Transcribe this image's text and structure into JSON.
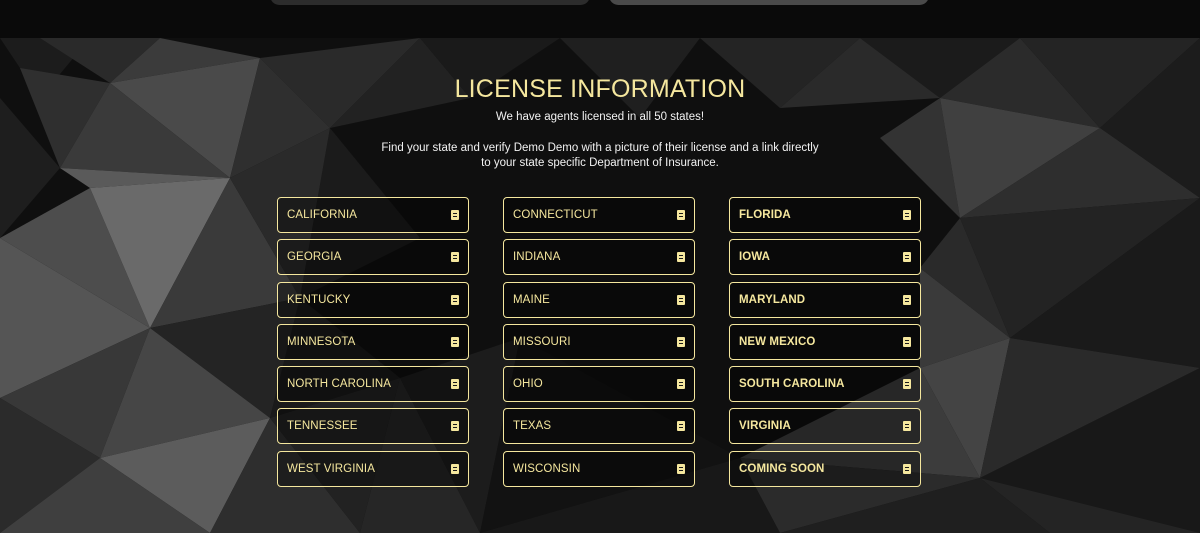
{
  "section": {
    "title": "LICENSE INFORMATION",
    "subtitle": "We have agents licensed in all 50 states!",
    "description": "Find your state and verify Demo Demo with a picture of their license and a link directly to your state specific Department of Insurance."
  },
  "states": [
    {
      "label": "CALIFORNIA",
      "icon": "document-icon"
    },
    {
      "label": "CONNECTICUT",
      "icon": "document-icon"
    },
    {
      "label": "FLORIDA",
      "icon": "document-icon"
    },
    {
      "label": "GEORGIA",
      "icon": "document-icon"
    },
    {
      "label": "INDIANA",
      "icon": "document-icon"
    },
    {
      "label": "IOWA",
      "icon": "document-icon"
    },
    {
      "label": "KENTUCKY",
      "icon": "document-icon"
    },
    {
      "label": "MAINE",
      "icon": "document-icon"
    },
    {
      "label": "MARYLAND",
      "icon": "document-icon"
    },
    {
      "label": "MINNESOTA",
      "icon": "document-icon"
    },
    {
      "label": "MISSOURI",
      "icon": "document-icon"
    },
    {
      "label": "NEW MEXICO",
      "icon": "document-icon"
    },
    {
      "label": "NORTH CAROLINA",
      "icon": "document-icon"
    },
    {
      "label": "OHIO",
      "icon": "document-icon"
    },
    {
      "label": "SOUTH CAROLINA",
      "icon": "document-icon"
    },
    {
      "label": "TENNESSEE",
      "icon": "document-icon"
    },
    {
      "label": "TEXAS",
      "icon": "document-icon"
    },
    {
      "label": "VIRGINIA",
      "icon": "document-icon"
    },
    {
      "label": "WEST VIRGINIA",
      "icon": "document-icon"
    },
    {
      "label": "WISCONSIN",
      "icon": "document-icon"
    },
    {
      "label": "COMING SOON",
      "icon": "document-icon"
    }
  ],
  "colors": {
    "accent": "#f5e79e",
    "text": "#f2f2f2",
    "background": "#0d0d0d"
  }
}
